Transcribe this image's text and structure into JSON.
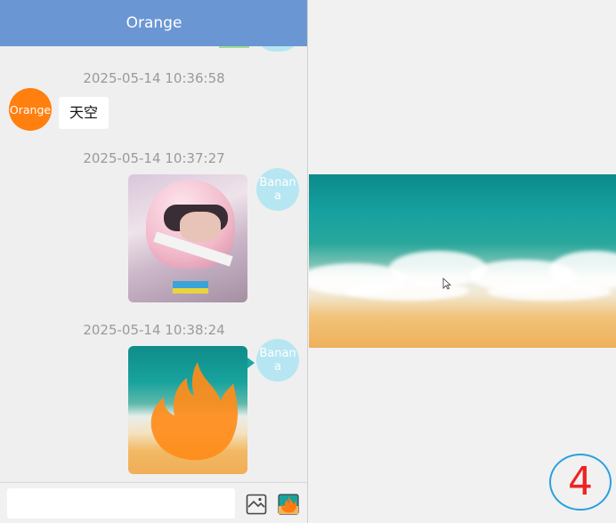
{
  "header": {
    "title": "Orange"
  },
  "messages": [
    {
      "timestamp": "2025-05-14 10:36:58",
      "sender": "Orange",
      "type": "text",
      "text": "天空"
    },
    {
      "timestamp": "2025-05-14 10:37:27",
      "sender": "Banana",
      "type": "image",
      "image": "helmet-portrait"
    },
    {
      "timestamp": "2025-05-14 10:38:24",
      "sender": "Banana",
      "type": "image",
      "image": "beach-with-flame"
    }
  ],
  "avatars": {
    "orange": {
      "label": "Orange",
      "color": "#ff7f0f"
    },
    "banana": {
      "label": "Banan a",
      "color": "#b6e6f1"
    }
  },
  "input": {
    "placeholder": "",
    "value": ""
  },
  "toolbar": {
    "icons": [
      "image-picker-icon",
      "flame-sticker-icon"
    ]
  },
  "viewer": {
    "image": "beach-waves",
    "page_number": "4"
  },
  "colors": {
    "header": "#6a97d3",
    "accent_badge_border": "#2aa0e0",
    "badge_text": "#ee2323"
  }
}
